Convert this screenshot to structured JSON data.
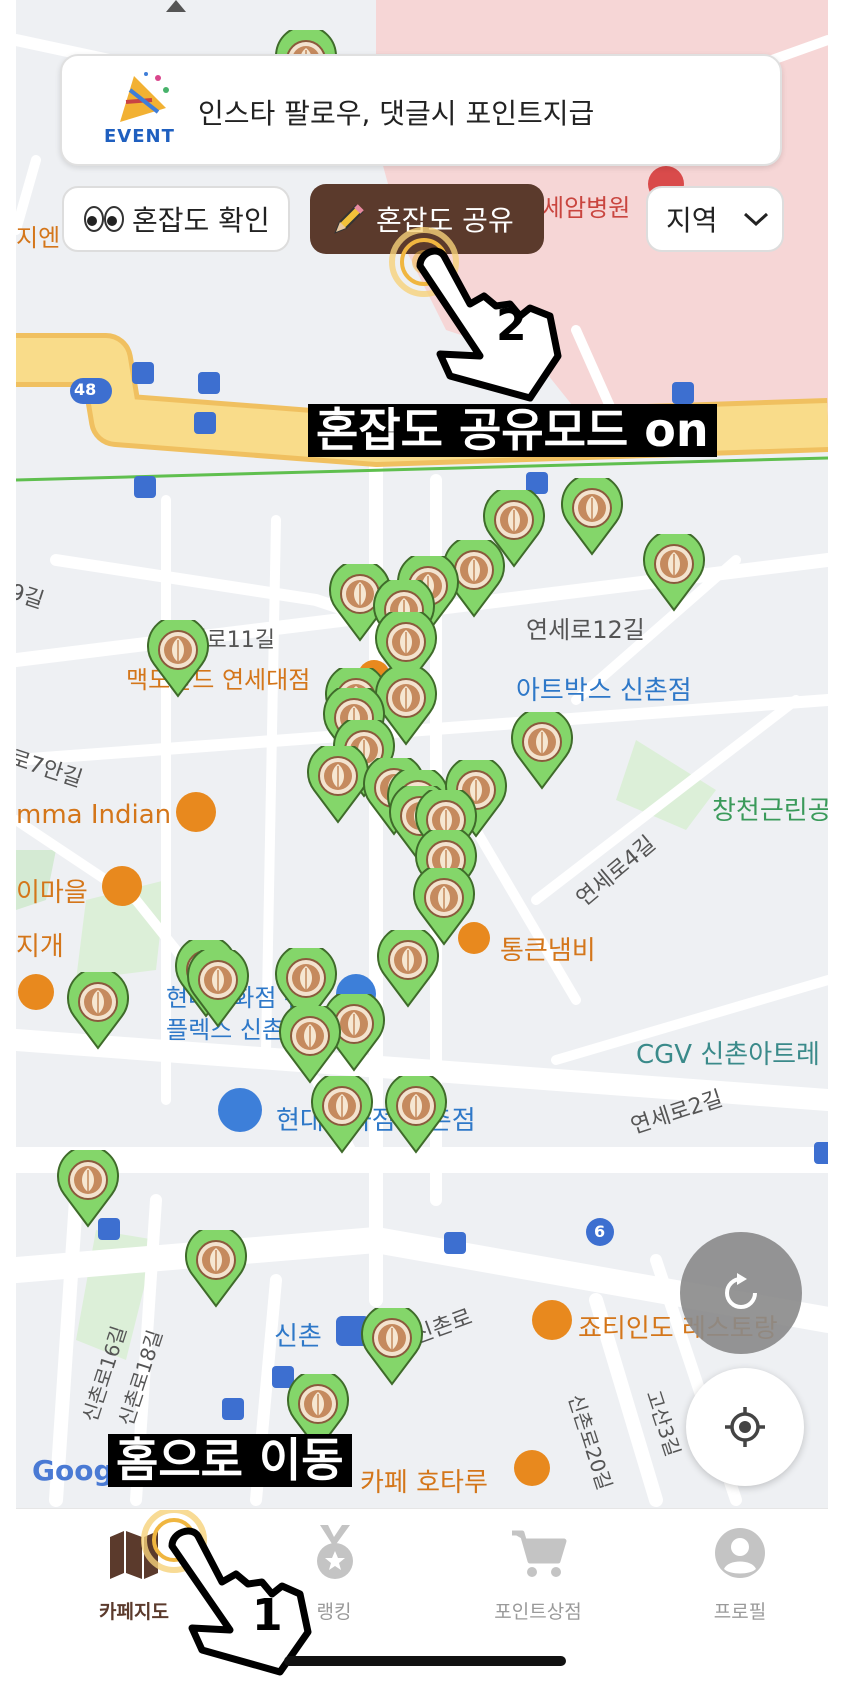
{
  "event_banner": {
    "icon": "party-popper-icon",
    "badge": "EVENT",
    "text": "인스타 팔로우, 댓글시 포인트지급"
  },
  "filters": {
    "check_label": "혼잡도 확인",
    "check_icon": "eyes-icon",
    "share_label": "혼잡도 공유",
    "share_icon": "pencil-icon",
    "region_label": "지역"
  },
  "annotations": {
    "share_mode": "혼잡도 공유모드 on",
    "home_move": "홈으로 이동",
    "step_1": "1",
    "step_2": "2"
  },
  "map_labels": {
    "yonsei11": "연세로11길",
    "yonsei12": "연세로12길",
    "mcd": "맥도날드 연세대점",
    "artbox": "아트박스 신촌점",
    "road7": "로7안길",
    "mma": "mma Indian",
    "changcheon": "창천근린공",
    "village": "이마을",
    "jigae": "지개",
    "yonsei4": "연세로4길",
    "tongkeun": "통큰냄비",
    "hyundai1": "현대백화점 유",
    "hyundai2": "플렉스 신촌점",
    "cgv": "CGV 신촌아트레",
    "yonsei2": "연세로2길",
    "hyundai_store": "현대백화점 신촌점",
    "sinchon": "신촌",
    "sinchonro": "신촌로",
    "jotiindo": "죠티인도 레스토랑",
    "sc16": "신촌로16길",
    "sc18": "신촌로18길",
    "sc20": "신촌로20길",
    "gosan3": "고산3길",
    "cafe": "카페 호타루",
    "severance": "세암병원",
    "road9": "9길",
    "bus48": "48",
    "bus6": "6",
    "google": "Google",
    "jien": "지엔"
  },
  "tabbar": {
    "items": [
      {
        "label": "카페지도",
        "icon": "map-icon",
        "active": true
      },
      {
        "label": "랭킹",
        "icon": "medal-icon",
        "active": false
      },
      {
        "label": "포인트상점",
        "icon": "cart-icon",
        "active": false
      },
      {
        "label": "프로필",
        "icon": "profile-icon",
        "active": false
      }
    ]
  },
  "cafe_markers": {
    "count": 40,
    "icon": "latte-art-icon"
  },
  "colors": {
    "accent_brown": "#5b3a2c",
    "pin_green": "#84d66a",
    "road_yellow": "#f6d27a",
    "poi_orange": "#e8891e",
    "poi_blue": "#3d7fd9"
  }
}
